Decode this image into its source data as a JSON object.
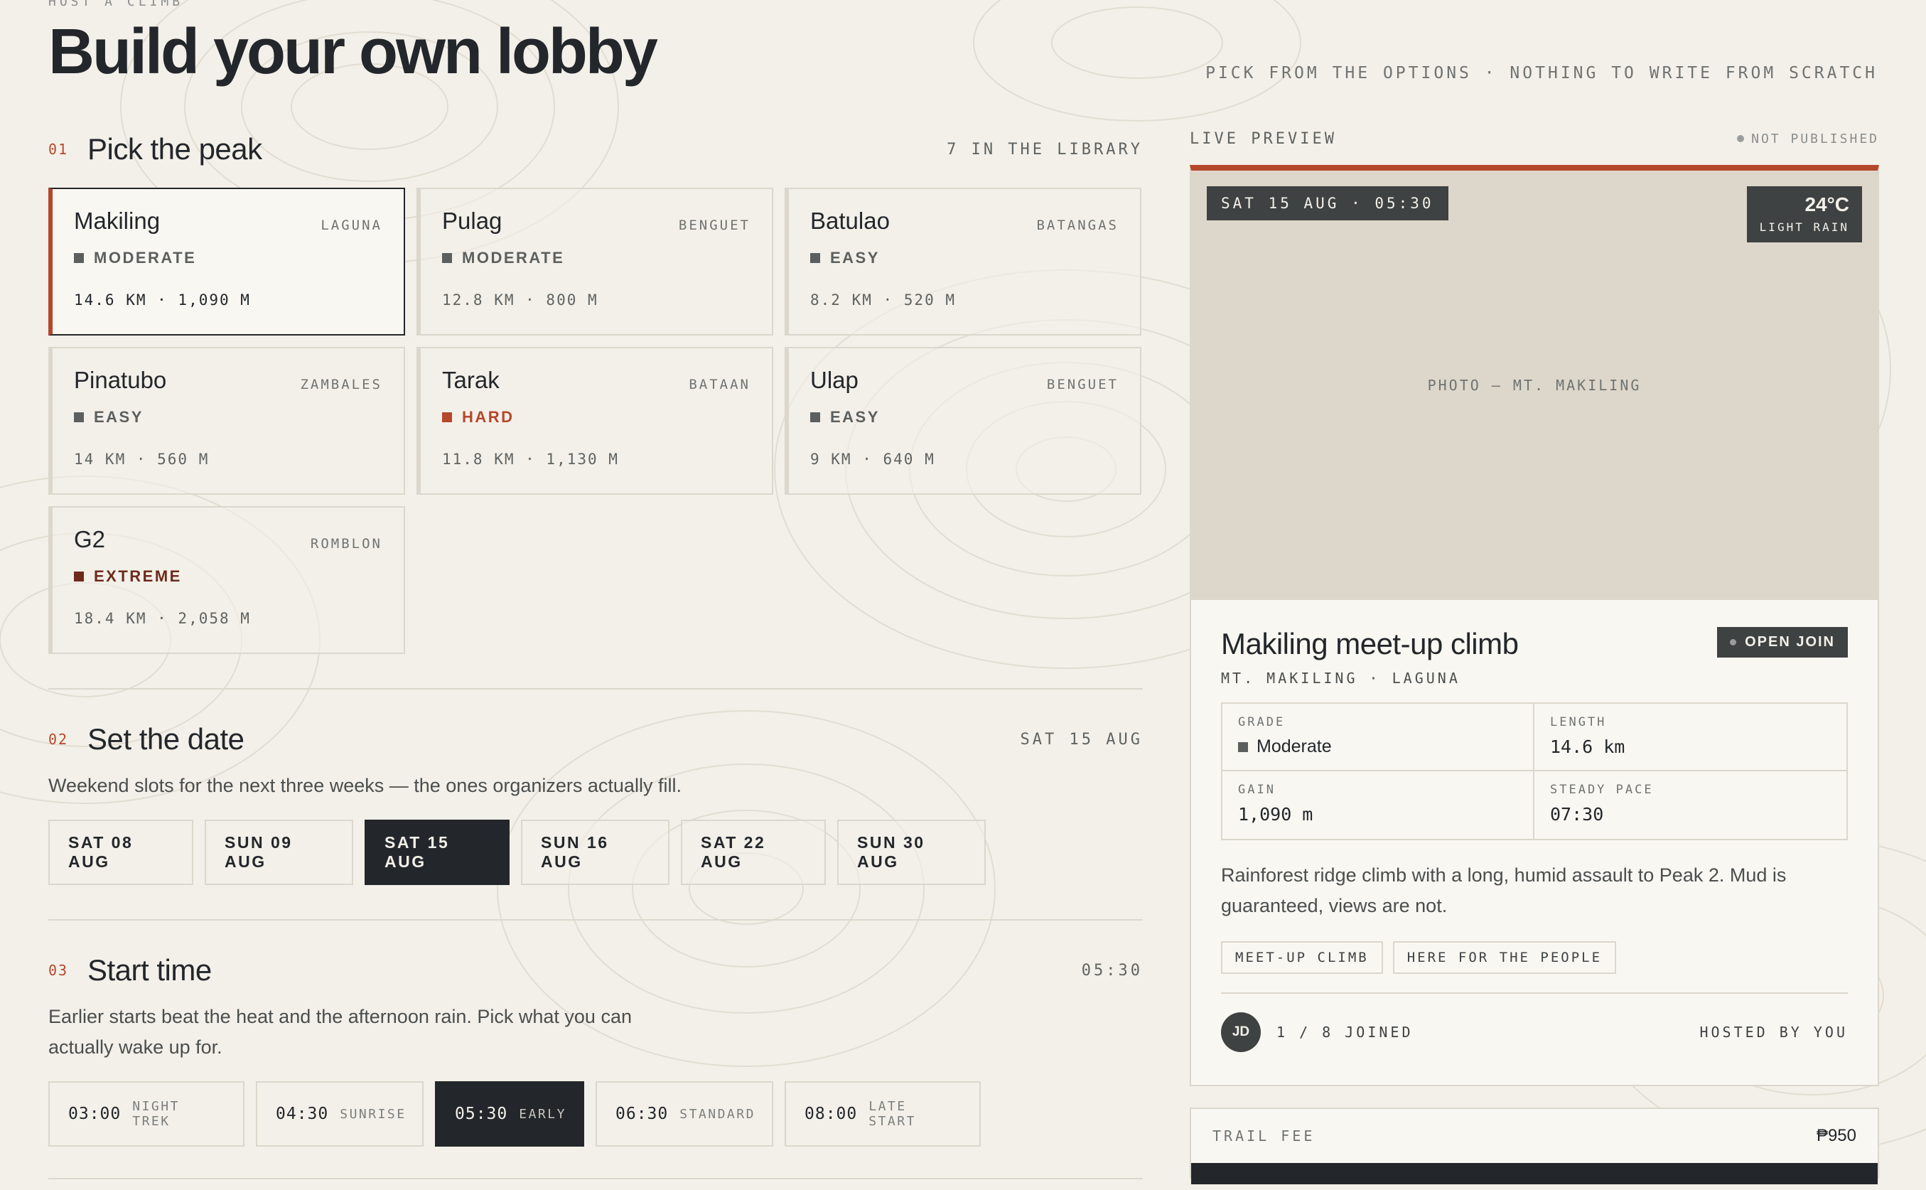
{
  "header": {
    "eyebrow": "HOST A CLIMB",
    "title": "Build your own lobby",
    "tagline": "PICK FROM THE OPTIONS · NOTHING TO WRITE FROM SCRATCH"
  },
  "peaks_section": {
    "num": "01",
    "title": "Pick the peak",
    "meta": "7 IN THE LIBRARY",
    "selected": "Makiling",
    "items": [
      {
        "name": "Makiling",
        "region": "LAGUNA",
        "difficulty": "MODERATE",
        "stats": "14.6 KM · 1,090 M"
      },
      {
        "name": "Pulag",
        "region": "BENGUET",
        "difficulty": "MODERATE",
        "stats": "12.8 KM · 800 M"
      },
      {
        "name": "Batulao",
        "region": "BATANGAS",
        "difficulty": "EASY",
        "stats": "8.2 KM · 520 M"
      },
      {
        "name": "Pinatubo",
        "region": "ZAMBALES",
        "difficulty": "EASY",
        "stats": "14 KM · 560 M"
      },
      {
        "name": "Tarak",
        "region": "BATAAN",
        "difficulty": "HARD",
        "stats": "11.8 KM · 1,130 M"
      },
      {
        "name": "Ulap",
        "region": "BENGUET",
        "difficulty": "EASY",
        "stats": "9 KM · 640 M"
      },
      {
        "name": "G2",
        "region": "ROMBLON",
        "difficulty": "EXTREME",
        "stats": "18.4 KM · 2,058 M"
      }
    ]
  },
  "date_section": {
    "num": "02",
    "title": "Set the date",
    "meta": "SAT 15 AUG",
    "description": "Weekend slots for the next three weeks — the ones organizers actually fill.",
    "options": [
      "SAT 08 AUG",
      "SUN 09 AUG",
      "SAT 15 AUG",
      "SUN 16 AUG",
      "SAT 22 AUG",
      "SUN 30 AUG"
    ],
    "selected": "SAT 15 AUG"
  },
  "time_section": {
    "num": "03",
    "title": "Start time",
    "meta": "05:30",
    "description": "Earlier starts beat the heat and the afternoon rain. Pick what you can actually wake up for.",
    "options": [
      {
        "time": "03:00",
        "label": "NIGHT TREK"
      },
      {
        "time": "04:30",
        "label": "SUNRISE"
      },
      {
        "time": "05:30",
        "label": "EARLY"
      },
      {
        "time": "06:30",
        "label": "STANDARD"
      },
      {
        "time": "08:00",
        "label": "LATE START"
      }
    ],
    "selected": "05:30"
  },
  "preview": {
    "label": "LIVE PREVIEW",
    "status": "NOT PUBLISHED",
    "photo_date": "SAT 15 AUG · 05:30",
    "weather_temp": "24°C",
    "weather_cond": "LIGHT RAIN",
    "photo_caption": "PHOTO — MT. MAKILING",
    "climb_title": "Makiling meet-up climb",
    "join_badge": "OPEN JOIN",
    "climb_sub": "MT. MAKILING · LAGUNA",
    "stats": {
      "grade_label": "GRADE",
      "grade_value": "Moderate",
      "length_label": "LENGTH",
      "length_value": "14.6 km",
      "gain_label": "GAIN",
      "gain_value": "1,090 m",
      "pace_label": "STEADY PACE",
      "pace_value": "07:30"
    },
    "blurb": "Rainforest ridge climb with a long, humid assault to Peak 2. Mud is guaranteed, views are not.",
    "tags": [
      "MEET-UP CLIMB",
      "HERE FOR THE PEOPLE"
    ],
    "avatar_initials": "JD",
    "joined": "1 / 8 JOINED",
    "hosted": "HOSTED BY YOU"
  },
  "fee": {
    "label": "TRAIL FEE",
    "value": "₱950"
  },
  "colors": {
    "background": "#f3f0e9",
    "ink": "#23272b",
    "accent": "#b5472b",
    "photo": "#ddd6ca"
  }
}
